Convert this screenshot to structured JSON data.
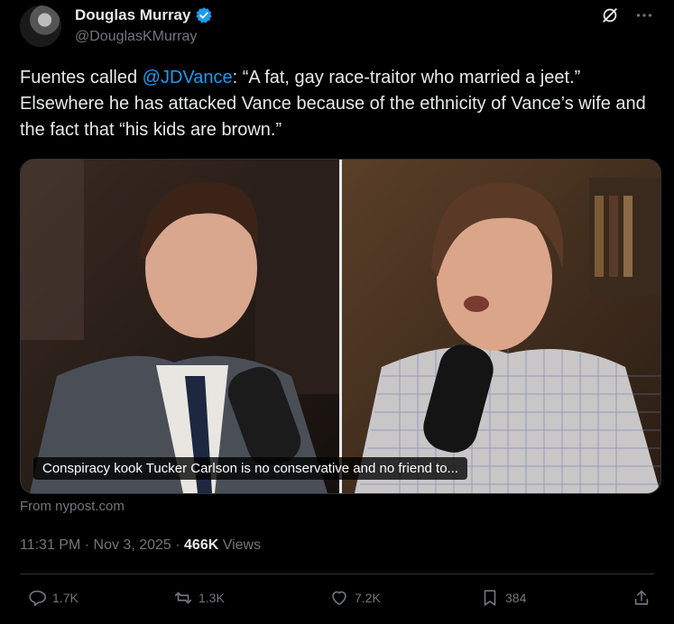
{
  "author": {
    "name": "Douglas Murray",
    "handle": "@DouglasKMurray"
  },
  "tweet": {
    "text_before": "Fuentes called ",
    "mention": "@JDVance",
    "text_after": ": “A fat, gay race-traitor who married a jeet.” Elsewhere he has attacked Vance because of the ethnicity of Vance’s wife and the fact that “his kids are brown.”"
  },
  "media": {
    "caption": "Conspiracy kook Tucker Carlson is no conservative and no friend to...",
    "source": "From nypost.com"
  },
  "meta": {
    "time": "11:31 PM",
    "date": "Nov 3, 2025",
    "views_count": "466K",
    "views_label": "Views"
  },
  "actions": {
    "replies": "1.7K",
    "reposts": "1.3K",
    "likes": "7.2K",
    "bookmarks": "384"
  },
  "colors": {
    "background": "#000000",
    "accent": "#1d9bf0",
    "muted": "#71767b",
    "text": "#e7e9ea"
  }
}
